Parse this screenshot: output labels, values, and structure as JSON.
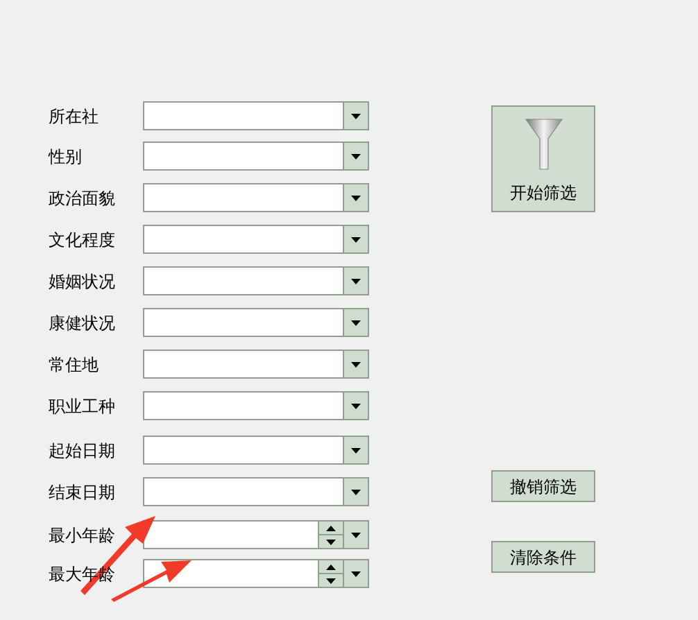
{
  "filters": [
    {
      "label": "所在社",
      "kind": "combo"
    },
    {
      "label": "性别",
      "kind": "combo"
    },
    {
      "label": "政治面貌",
      "kind": "combo"
    },
    {
      "label": "文化程度",
      "kind": "combo"
    },
    {
      "label": "婚姻状况",
      "kind": "combo"
    },
    {
      "label": "康健状况",
      "kind": "combo"
    },
    {
      "label": "常住地",
      "kind": "combo"
    },
    {
      "label": "职业工种",
      "kind": "combo"
    },
    {
      "label": "起始日期",
      "kind": "combo"
    },
    {
      "label": "结束日期",
      "kind": "combo"
    },
    {
      "label": "最小年龄",
      "kind": "spin"
    },
    {
      "label": "最大年龄",
      "kind": "spin"
    }
  ],
  "buttons": [
    {
      "label": "开始筛选",
      "kind": "primary"
    },
    {
      "label": "撤销筛选",
      "kind": "plain"
    },
    {
      "label": "清除条件",
      "kind": "plain"
    }
  ]
}
